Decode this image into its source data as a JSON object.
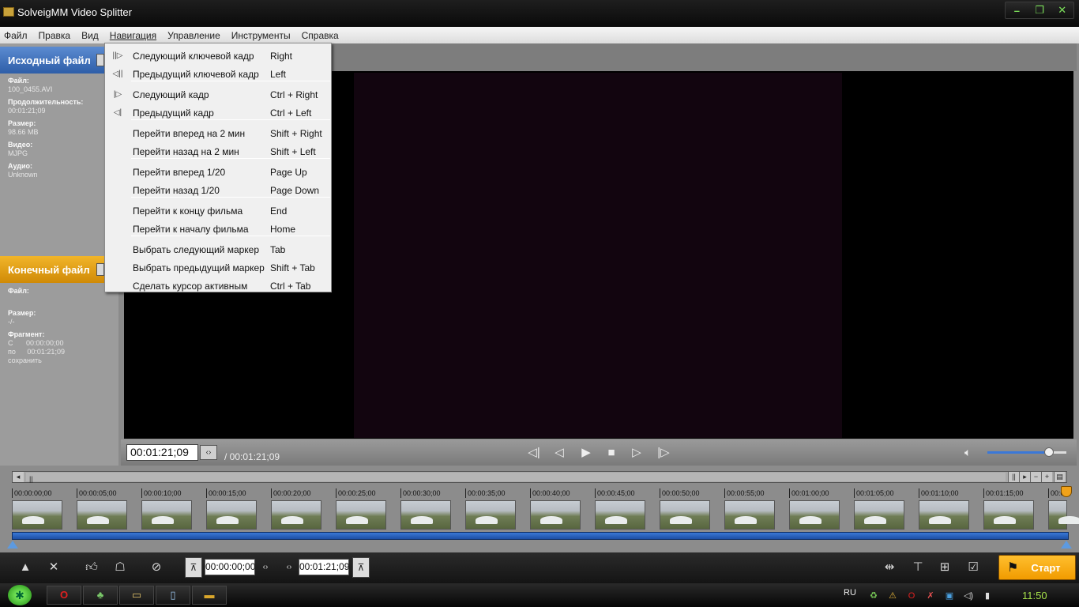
{
  "window": {
    "title": "SolveigMM Video Splitter",
    "controls": [
      "–",
      "❐",
      "✕"
    ]
  },
  "menubar": {
    "items": [
      "Файл",
      "Правка",
      "Вид",
      "Навигация",
      "Управление",
      "Инструменты",
      "Справка"
    ],
    "active": "Навигация"
  },
  "navigation_menu": {
    "items": [
      {
        "icon": "next-keyframe-icon",
        "label": "Следующий ключевой кадр",
        "shortcut": "Right"
      },
      {
        "icon": "prev-keyframe-icon",
        "label": "Предыдущий ключевой кадр",
        "shortcut": "Left"
      },
      {
        "icon": "next-frame-icon",
        "label": "Следующий кадр",
        "shortcut": "Ctrl + Right"
      },
      {
        "icon": "prev-frame-icon",
        "label": "Предыдущий кадр",
        "shortcut": "Ctrl + Left"
      },
      {
        "icon": "",
        "label": "Перейти вперед на 2 мин",
        "shortcut": "Shift + Right"
      },
      {
        "icon": "",
        "label": "Перейти назад на 2 мин",
        "shortcut": "Shift + Left"
      },
      {
        "icon": "",
        "label": "Перейти вперед 1/20",
        "shortcut": "Page Up"
      },
      {
        "icon": "",
        "label": "Перейти назад 1/20",
        "shortcut": "Page Down"
      },
      {
        "icon": "",
        "label": "Перейти к концу фильма",
        "shortcut": "End"
      },
      {
        "icon": "",
        "label": "Перейти к началу фильма",
        "shortcut": "Home"
      },
      {
        "icon": "",
        "label": "Выбрать следующий маркер",
        "shortcut": "Tab"
      },
      {
        "icon": "",
        "label": "Выбрать предыдущий маркер",
        "shortcut": "Shift + Tab"
      },
      {
        "icon": "",
        "label": "Сделать курсор активным",
        "shortcut": "Ctrl + Tab"
      }
    ]
  },
  "source_panel": {
    "title": "Исходный файл",
    "file_label": "Файл:",
    "file_value": "100_0455.AVI",
    "duration_label": "Продолжительность:",
    "duration_value": "00:01:21;09",
    "size_label": "Размер:",
    "size_value": "98.66 MB",
    "video_label": "Видео:",
    "video_value": "MJPG",
    "audio_label": "Аудио:",
    "audio_value": "Unknown"
  },
  "output_panel": {
    "title": "Конечный файл",
    "file_label": "Файл:",
    "size_label": "Размер:",
    "size_value": "-/-",
    "fragment_label": "Фрагмент:",
    "from_label": "С",
    "from_value": "00:00:00;00",
    "to_label": "по",
    "to_value": "00:01:21;09",
    "save_text": "сохранить"
  },
  "player": {
    "current_time": "00:01:21;09",
    "total_time": "/ 00:01:21;09",
    "stepper": "‹›",
    "volume": 0.78,
    "accent": "#3b78d8"
  },
  "timeline": {
    "ticks": [
      "00:00:00;00",
      "00:00:05;00",
      "00:00:10;00",
      "00:00:15;00",
      "00:00:20;00",
      "00:00:25;00",
      "00:00:30;00",
      "00:00:35;00",
      "00:00:40;00",
      "00:00:45;00",
      "00:00:50;00",
      "00:00:55;00",
      "00:01:00;00",
      "00:01:05;00",
      "00:01:10;00",
      "00:01:15;00",
      "00:0"
    ],
    "scroll_left": "◂",
    "scroll_grip": "||"
  },
  "bottom": {
    "start_time": "00:00:00;00",
    "end_time": "00:01:21;09",
    "start_button": "Старт"
  },
  "taskbar": {
    "lang": "RU",
    "clock": "11:50"
  }
}
